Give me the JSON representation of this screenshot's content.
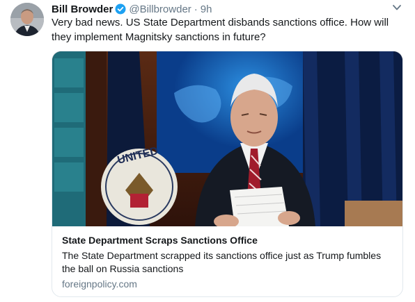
{
  "tweet": {
    "display_name": "Bill Browder",
    "handle": "@Billbrowder",
    "separator": "·",
    "time": "9h",
    "text": "Very bad news. US State Department disbands sanctions office. How will they implement Magnitsky sanctions in future?"
  },
  "card": {
    "title": "State Department Scraps Sanctions Office",
    "description": "The State Department scrapped its sanctions office just as Trump fumbles the ball on Russia sanctions",
    "domain": "foreignpolicy.com",
    "image_text": "UNITED"
  },
  "icons": {
    "verified": "verified-badge-icon",
    "caret": "chevron-down-icon"
  },
  "colors": {
    "verified_blue": "#1da1f2",
    "secondary_text": "#657786",
    "border": "#e1e8ed"
  }
}
